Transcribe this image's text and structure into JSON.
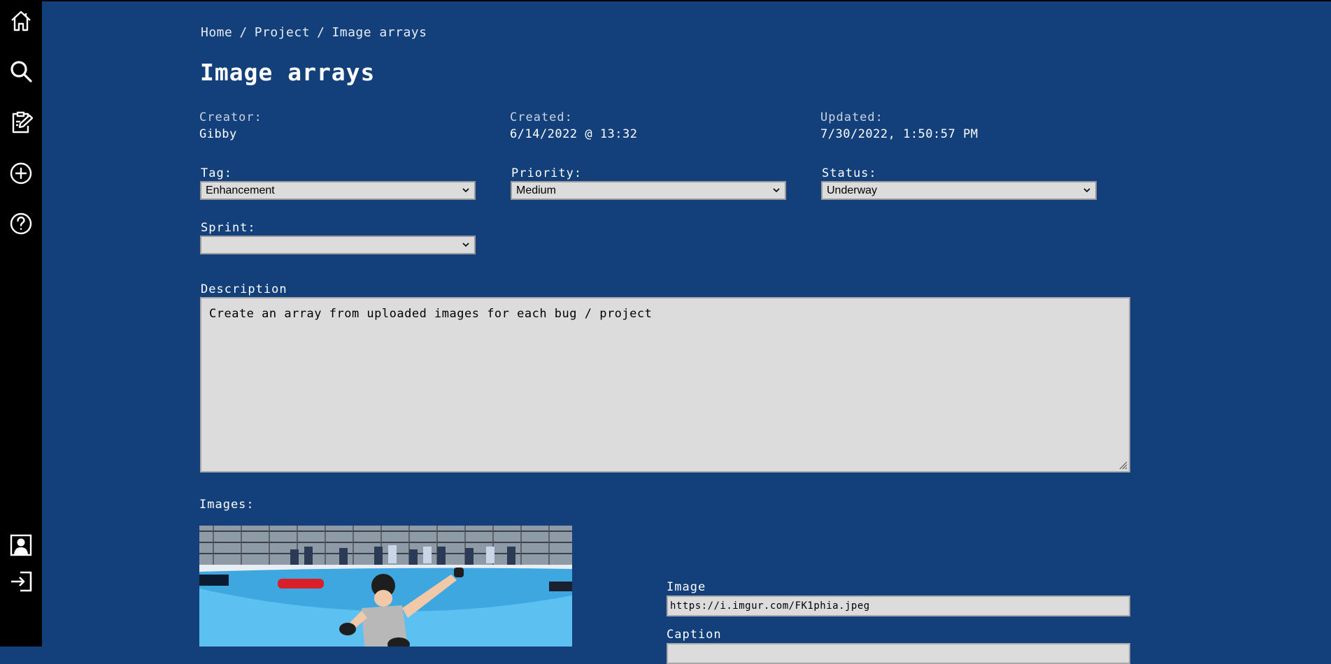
{
  "sidebar": {
    "top_items": [
      {
        "icon": "home-icon"
      },
      {
        "icon": "search-icon"
      },
      {
        "icon": "edit-clipboard-icon"
      },
      {
        "icon": "add-circle-icon"
      },
      {
        "icon": "help-icon"
      }
    ],
    "bottom_items": [
      {
        "icon": "profile-icon"
      },
      {
        "icon": "login-icon"
      }
    ]
  },
  "breadcrumb": [
    "Home",
    "Project",
    "Image arrays"
  ],
  "page_title": "Image arrays",
  "meta": {
    "creator_label": "Creator:",
    "creator_value": "Gibby",
    "created_label": "Created:",
    "created_value": "6/14/2022 @ 13:32",
    "updated_label": "Updated:",
    "updated_value": "7/30/2022, 1:50:57 PM"
  },
  "fields": {
    "tag_label": "Tag:",
    "tag_value": "Enhancement",
    "priority_label": "Priority:",
    "priority_value": "Medium",
    "status_label": "Status:",
    "status_value": "Underway",
    "sprint_label": "Sprint:",
    "sprint_value": ""
  },
  "description": {
    "label": "Description",
    "value": "Create an array from uploaded images for each bug / project"
  },
  "images": {
    "label": "Images:",
    "image_label": "Image",
    "image_url": "https://i.imgur.com/FK1phia.jpeg",
    "caption_label": "Caption"
  },
  "colors": {
    "background": "#13407a",
    "sidebar": "#000000",
    "field_bg": "#dcdcdc"
  }
}
